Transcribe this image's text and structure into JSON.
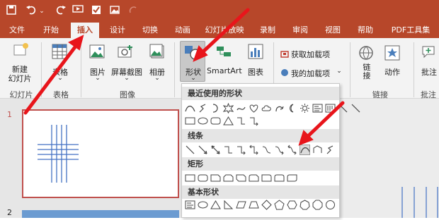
{
  "colors": {
    "brand": "#b7472a",
    "arrow": "#e8151b",
    "slide_border": "#c0504d",
    "line_blue": "#4472c4"
  },
  "quick_access": {
    "icons": [
      "save-icon",
      "undo-icon",
      "dropdown-icon",
      "redo-icon",
      "present-icon",
      "review-icon",
      "image-icon",
      "draw-icon"
    ]
  },
  "tabs": [
    {
      "label": "文件"
    },
    {
      "label": "开始"
    },
    {
      "label": "插入"
    },
    {
      "label": "设计"
    },
    {
      "label": "切换"
    },
    {
      "label": "动画"
    },
    {
      "label": "幻灯片放映"
    },
    {
      "label": "录制"
    },
    {
      "label": "审阅"
    },
    {
      "label": "视图"
    },
    {
      "label": "帮助"
    },
    {
      "label": "PDF工具集"
    }
  ],
  "ribbon": {
    "new_slide": "新建\n幻灯片",
    "slides_group": "幻灯片",
    "table": "表格",
    "table_group": "表格",
    "picture": "图片",
    "screenshot": "屏幕截图",
    "album": "相册",
    "image_group": "图像",
    "shapes": "形状",
    "smartart": "SmartArt",
    "chart": "图表",
    "get_addins": "获取加载项",
    "my_addins": "我的加载项",
    "link": "链\n接",
    "action": "动作",
    "link_group": "链接",
    "comment": "批注",
    "comment_group": "批注"
  },
  "shapes_menu": {
    "recent": "最近使用的形状",
    "lines": "线条",
    "rect": "矩形",
    "basic": "基本形状"
  },
  "slides": [
    {
      "number": "1"
    },
    {
      "number": "2"
    }
  ]
}
